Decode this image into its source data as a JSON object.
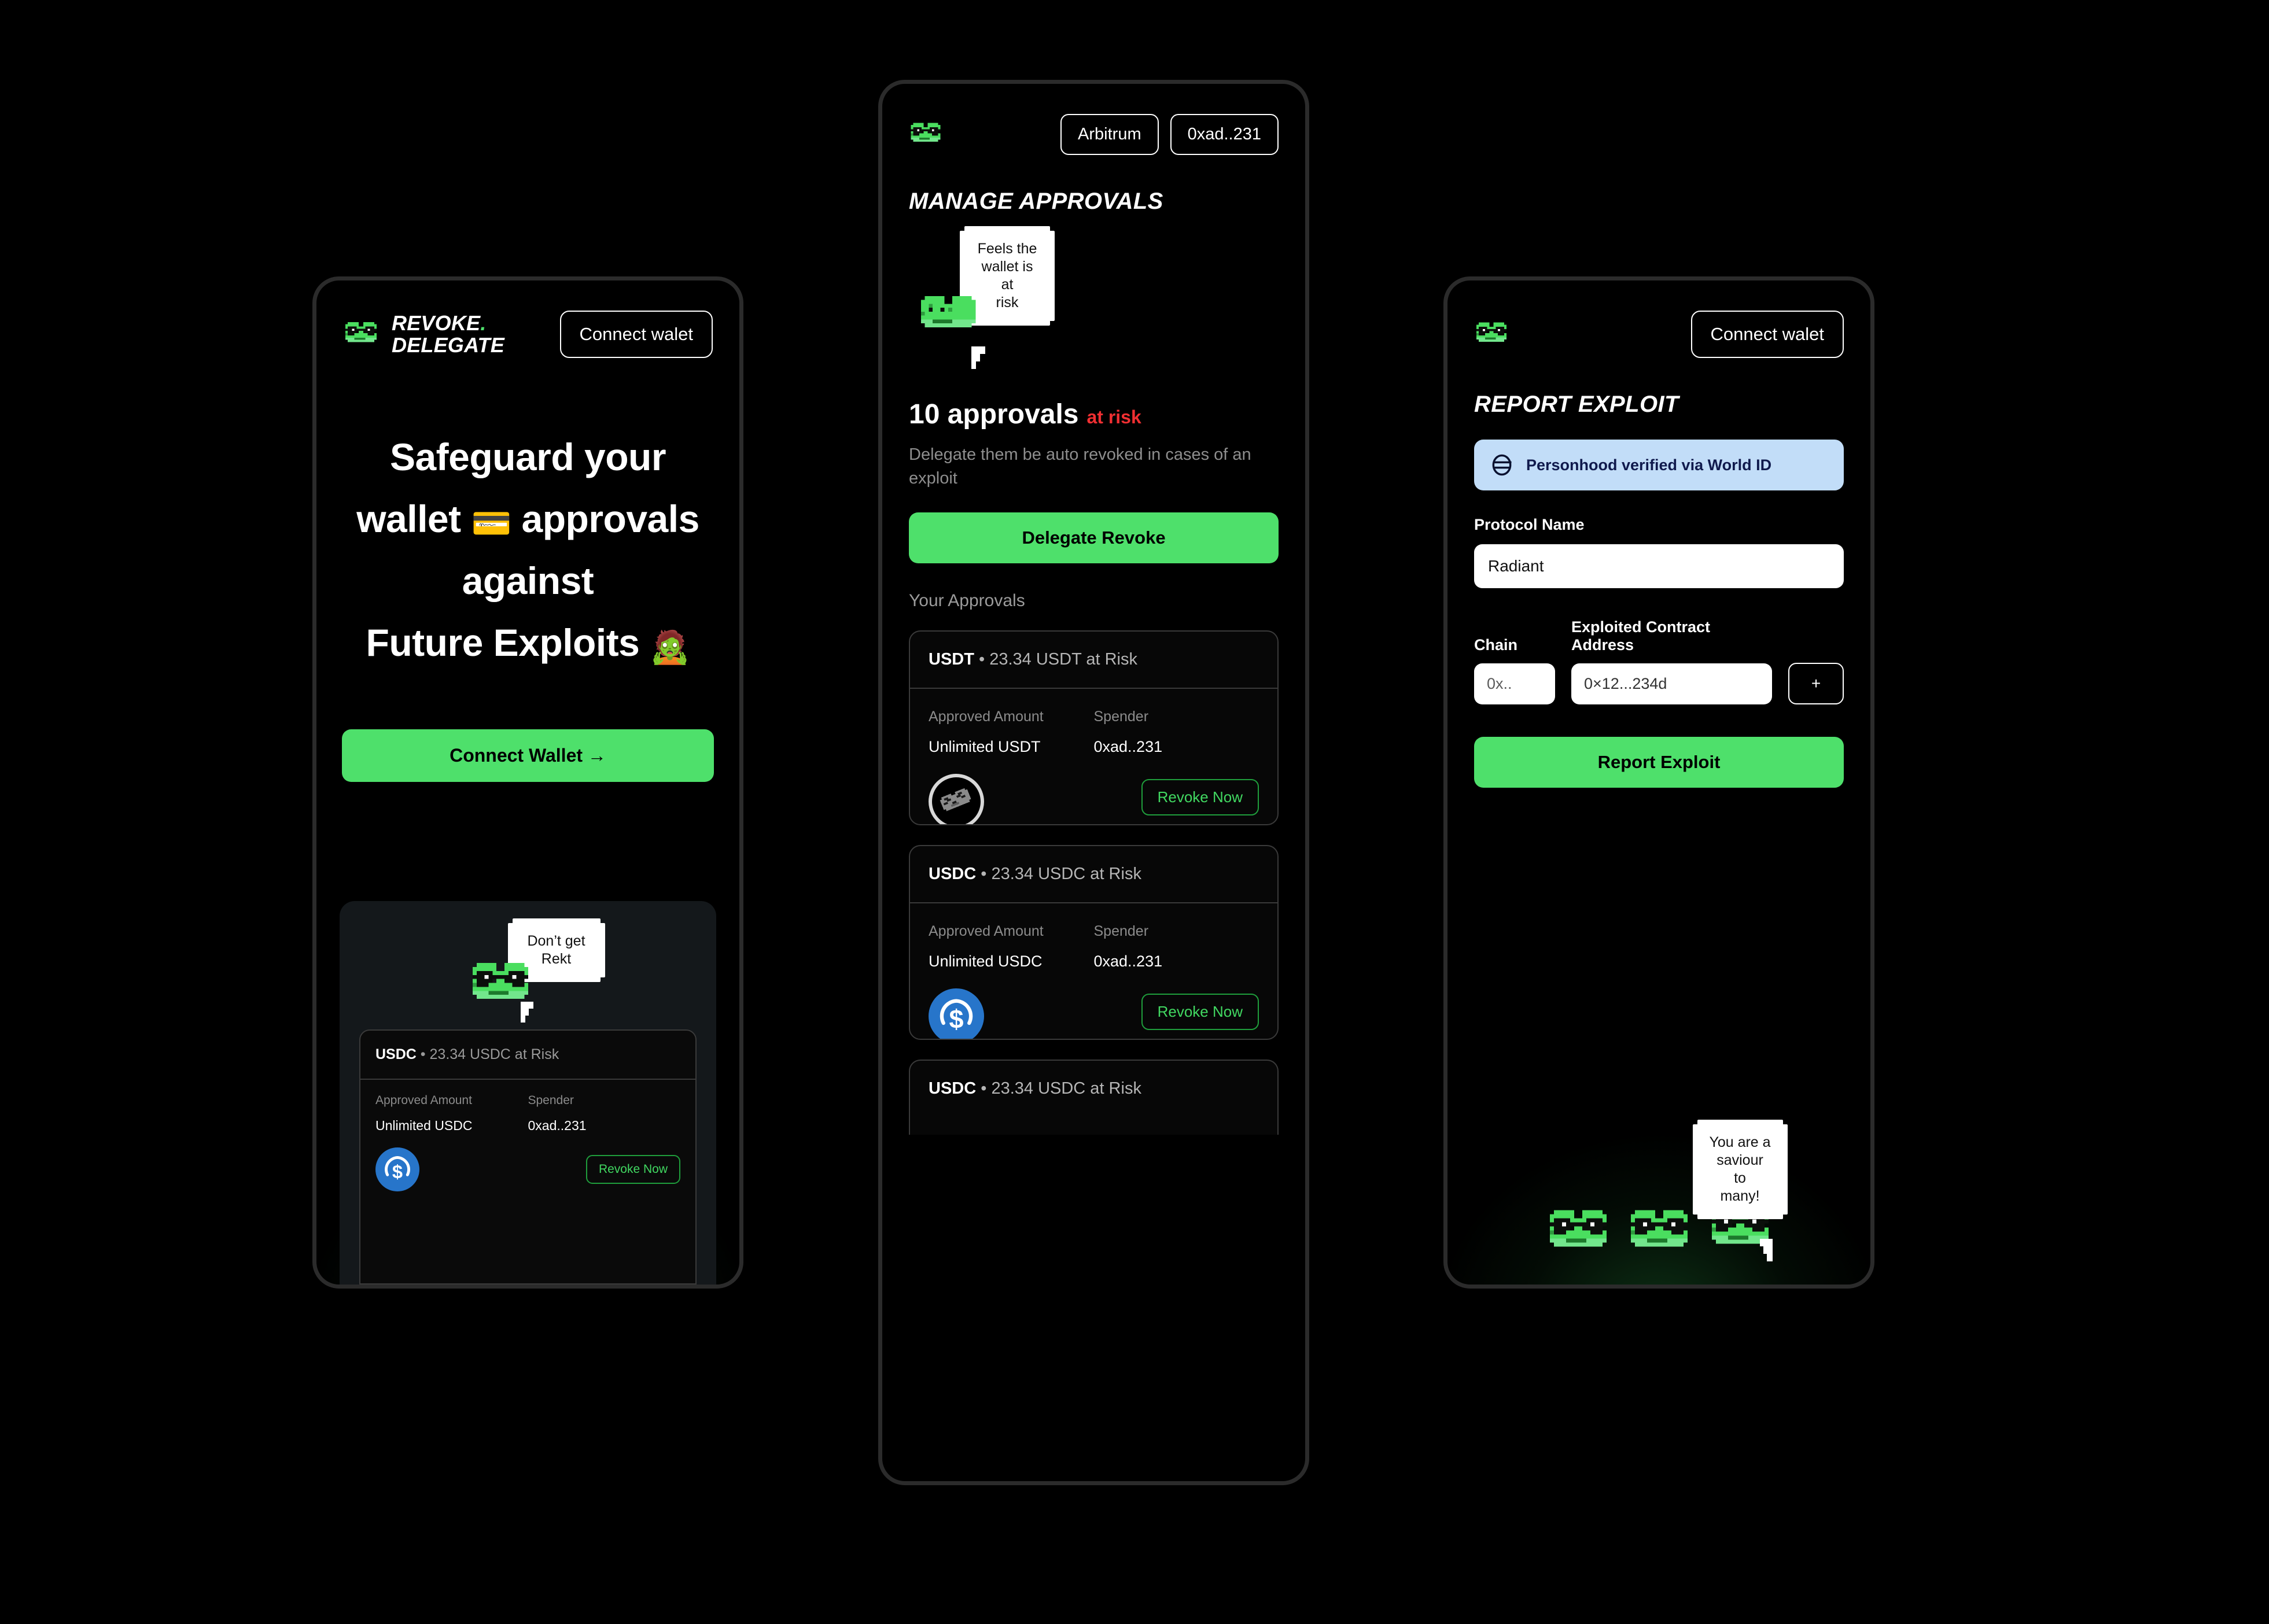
{
  "brand": {
    "line1": "REVOKE",
    "dot": ".",
    "line2": "DELEGATE",
    "logo_icon": "frog-sunglasses-icon"
  },
  "colors": {
    "accent_green": "#4ee06b",
    "risk_red": "#f02f32",
    "revoke_green": "#41d861",
    "usdc_blue": "#2775ca",
    "worldid_bg": "#c2ddf8",
    "worldid_text": "#101a4d",
    "panel_bg": "#000000",
    "card_bg": "#14181b"
  },
  "landing": {
    "connect_wallet_header": "Connect walet",
    "headline_1": "Safeguard your",
    "headline_2a": "wallet ",
    "headline_emoji_wallet": "💳",
    "headline_2b": " approvals",
    "headline_3": "against",
    "headline_4": "Future Exploits ",
    "headline_emoji_zombie": "🧟",
    "cta": "Connect Wallet →",
    "bubble": "Don’t get\nRekt",
    "bubble_line1": "Don’t get",
    "bubble_line2": "Rekt",
    "preview_card": {
      "token": "USDC",
      "separator": "•",
      "at_risk": "23.34 USDC at Risk",
      "col_amount_label": "Approved Amount",
      "col_spender_label": "Spender",
      "amount_value": "Unlimited USDC",
      "spender_value": "0xad..231",
      "revoke_label": "Revoke Now",
      "token_icon": "usdc-coin-icon"
    }
  },
  "approvals": {
    "chain_selector": "Arbitrum",
    "wallet_address": "0xad..231",
    "title": "MANAGE APPROVALS",
    "bubble_line1": "Feels the",
    "bubble_line2": "wallet is at",
    "bubble_line3": "risk",
    "stat_count": "10 approvals",
    "stat_risk": "at risk",
    "subtitle": "Delegate them be auto revoked in cases of an exploit",
    "delegate_button": "Delegate Revoke",
    "list_label": "Your Approvals",
    "columns": {
      "amount": "Approved Amount",
      "spender": "Spender"
    },
    "cards": [
      {
        "token": "USDT",
        "separator": "•",
        "at_risk": "23.34 USDT at Risk",
        "amount_value": "Unlimited USDT",
        "spender_value": "0xad..231",
        "revoke_label": "Revoke Now",
        "token_icon": "usdt-pixel-frog-icon"
      },
      {
        "token": "USDC",
        "separator": "•",
        "at_risk": "23.34 USDC at Risk",
        "amount_value": "Unlimited USDC",
        "spender_value": "0xad..231",
        "revoke_label": "Revoke Now",
        "token_icon": "usdc-coin-icon"
      },
      {
        "token": "USDC",
        "separator": "•",
        "at_risk": "23.34 USDC at Risk",
        "amount_value": "",
        "spender_value": "",
        "revoke_label": "",
        "token_icon": ""
      }
    ]
  },
  "report": {
    "connect_wallet_header": "Connect walet",
    "title": "REPORT EXPLOIT",
    "worldid_badge": "Personhood verified via World ID",
    "worldid_icon": "world-id-globe-icon",
    "protocol_label": "Protocol Name",
    "protocol_value": "Radiant",
    "chain_label": "Chain",
    "chain_value": "0x..",
    "contract_label": "Exploited Contract Address",
    "contract_value": "0×12...234d",
    "add_button": "+",
    "submit_button": "Report Exploit",
    "bubble_line1": "You are a",
    "bubble_line2": "saviour to",
    "bubble_line3": "many!"
  }
}
